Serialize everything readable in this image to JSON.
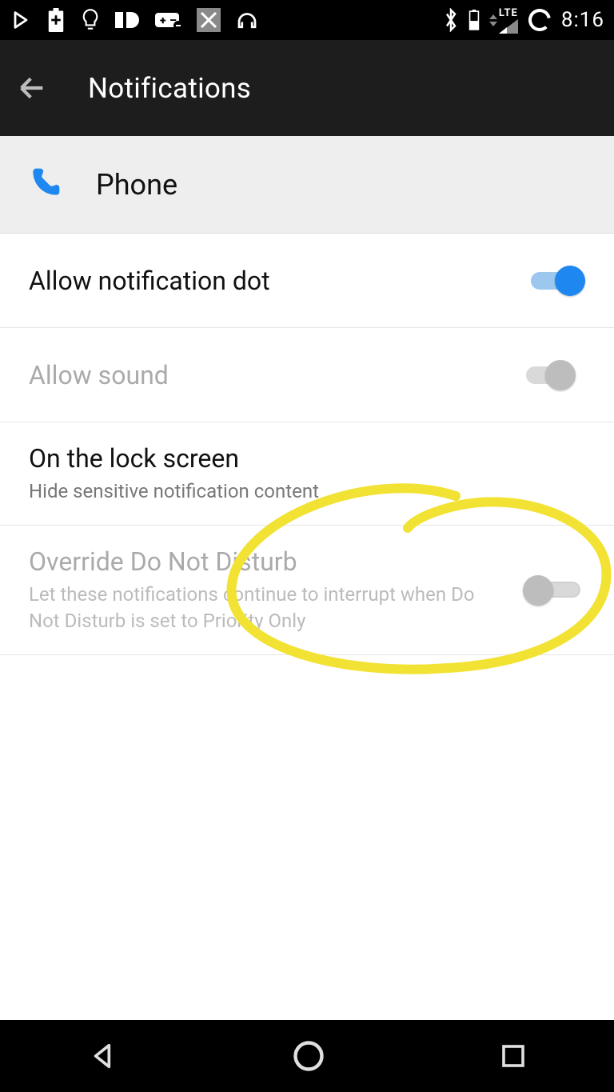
{
  "status": {
    "time": "8:16",
    "lte": "LTE"
  },
  "appbar": {
    "title": "Notifications"
  },
  "phone_row": {
    "label": "Phone"
  },
  "rows": {
    "allow_dot": {
      "title": "Allow notification dot"
    },
    "allow_sound": {
      "title": "Allow sound"
    },
    "lock_screen": {
      "title": "On the lock screen",
      "sub": "Hide sensitive notification content"
    },
    "override_dnd": {
      "title": "Override Do Not Disturb",
      "sub": "Let these notifications continue to interrupt when Do Not Disturb is set to Priority Only"
    }
  }
}
